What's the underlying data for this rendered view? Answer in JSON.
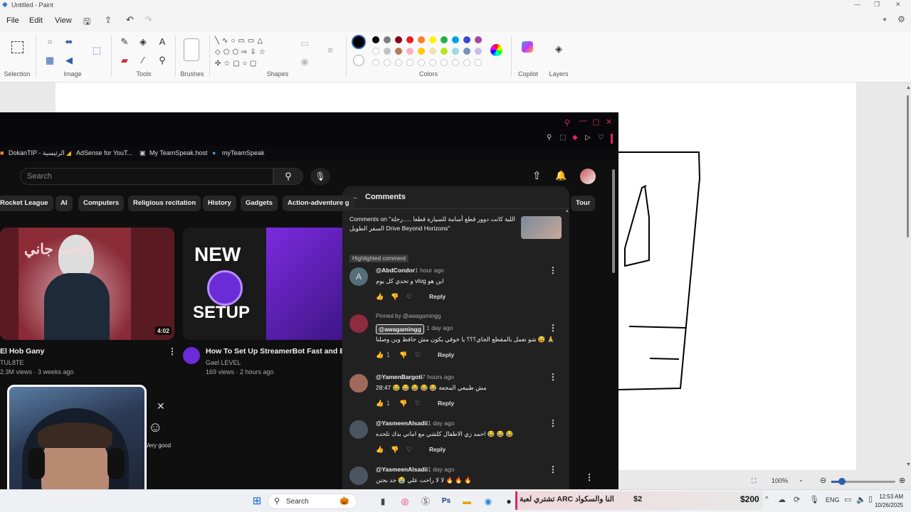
{
  "paint": {
    "title": "Untitled - Paint",
    "menu": {
      "file": "File",
      "edit": "Edit",
      "view": "View"
    },
    "groups": {
      "selection": "Selection",
      "image": "Image",
      "tools": "Tools",
      "brushes": "Brushes",
      "shapes": "Shapes",
      "colors": "Colors",
      "copilot": "Copilot",
      "layers": "Layers"
    },
    "palette": [
      "#000000",
      "#7f7f7f",
      "#880015",
      "#ed1c24",
      "#ff7f27",
      "#fff200",
      "#22b14c",
      "#00a2e8",
      "#3f48cc",
      "#a349a4"
    ],
    "palette2": [
      "#ffffff",
      "#c3c3c3",
      "#b97a57",
      "#ffaec9",
      "#ffc90e",
      "#efe4b0",
      "#b5e61d",
      "#99d9ea",
      "#7092be",
      "#c8bfe7"
    ],
    "zoom": "100%"
  },
  "browser": {
    "bookmarks": [
      "DokanTIP - الرئيسية",
      "AdSense for YouT...",
      "My TeamSpeak.host",
      "myTeamSpeak"
    ],
    "search_placeholder": "Search",
    "chips": [
      "Rocket League",
      "AI",
      "Computers",
      "Religious recitation",
      "History",
      "Gadgets",
      "Action-adventure g",
      "Tour"
    ],
    "videos": [
      {
        "thumb_text": "الحب جاني",
        "duration": "4:02",
        "title": "El Hob Gany",
        "channel": "TUL8TE",
        "meta": "2.3M views · 3 weeks ago"
      },
      {
        "thumb_text": "NEW",
        "thumb_text2": "SETUP",
        "title": "How To Set Up StreamerBot Fast and Ea",
        "channel": "Gael LEVEL",
        "meta": "169 views · 2 hours ago"
      }
    ],
    "survey": {
      "option": "Very good"
    }
  },
  "comments": {
    "title": "Comments",
    "video_ref": "Comments on \"اللية كانت دوور قطع أسامة للسيارة قطعا .....رحلة السفر الطويل Drive Beyond Horizons\"",
    "highlighted": "Highlighted comment",
    "reply": "Reply",
    "items": [
      {
        "user": "@AbdCondor",
        "time": "1 hour ago",
        "text": "و تحدي كل يوم vlog اين هو",
        "likes": "",
        "avatar": "A",
        "avatar_color": "#546e7a"
      },
      {
        "pinned": "Pinned by @awagamingg",
        "user": "@awagamingg",
        "time": "1 day ago",
        "text": "شو تعمل بالمقطع الجاي؟؟؟ يا خوفي يكون مش حافظ وين وصلنا 😅 🙏 🙏 🙏",
        "likes": "1",
        "avatar_color": "#8d2b3f"
      },
      {
        "user": "@YamenBargoti",
        "time": "7 hours ago",
        "text": "مش طبيعي المجعة 😂 😂 😂 😂 😂 28:47",
        "likes": "1",
        "avatar_color": "#a06a5a"
      },
      {
        "user": "@YasmeenAlsadii",
        "time": "1 day ago",
        "text": "احمد زي الاطفال كلشي مع اماني بدك تلحده 😂 😂 😂",
        "likes": "",
        "avatar_color": "#4a5560"
      },
      {
        "user": "@YasmeenAlsadii",
        "time": "1 day ago",
        "text": "لا لا راحت علي 😭 جد بجنن 🔥 🔥 🔥",
        "likes": "",
        "avatar_color": "#4a5560"
      }
    ]
  },
  "taskbar": {
    "search": "Search",
    "ticker": "تشتري لعبة ARC النا والسكواد",
    "price1": "$2",
    "price2": "$200",
    "lang": "ENG",
    "time": "12:53 AM",
    "date": "10/26/2025"
  }
}
